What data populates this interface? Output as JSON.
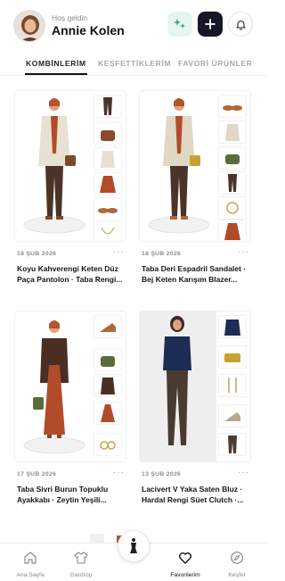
{
  "header": {
    "greeting": "Hoş geldin",
    "user_name": "Annie Kolen"
  },
  "tabs": [
    {
      "label": "KOMBİNLERİM",
      "active": true
    },
    {
      "label": "KEŞFETTİKLERİM",
      "active": false
    },
    {
      "label": "FAVORİ ÜRÜNLER",
      "active": false
    }
  ],
  "outfits": [
    {
      "date": "18 ŞUB 2026",
      "title": "Koyu Kahverengi Keten Düz Paça Pantolon · Taba Rengi..."
    },
    {
      "date": "18 ŞUB 2026",
      "title": "Taba Deri Espadril Sandalet · Bej Keten Karışım Blazer..."
    },
    {
      "date": "17 ŞUB 2026",
      "title": "Taba Sivri Burun Topuklu Ayakkabı · Zeytin Yeşili..."
    },
    {
      "date": "13 ŞUB 2026",
      "title": "Lacivert V Yaka Saten Bluz · Hardal Rengi Süet Clutch ·..."
    }
  ],
  "more_label": "···",
  "bottom_nav": [
    {
      "label": "Ana Sayfa",
      "icon": "home-icon",
      "active": false
    },
    {
      "label": "Gardrop",
      "icon": "shirt-icon",
      "active": false
    },
    {
      "label": "Favorilerim",
      "icon": "heart-icon",
      "active": true
    },
    {
      "label": "Keşfet",
      "icon": "compass-icon",
      "active": false
    }
  ],
  "colors": {
    "accent_dark": "#141826",
    "magic_bg": "#e6f6ee",
    "magic_icon": "#2fa36b",
    "inactive_text": "#a8a8a8"
  }
}
